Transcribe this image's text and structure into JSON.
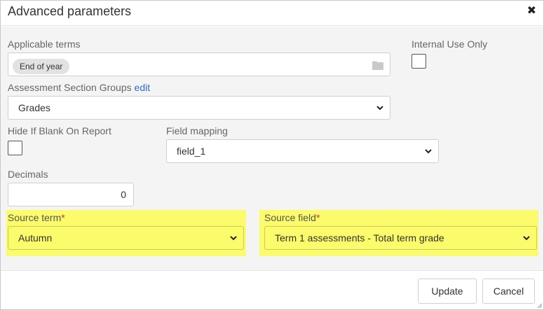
{
  "dialog": {
    "title": "Advanced parameters"
  },
  "applicable_terms": {
    "label": "Applicable terms",
    "tags": [
      "End of year"
    ]
  },
  "internal_use_only": {
    "label": "Internal Use Only",
    "checked": false
  },
  "assessment_section_groups": {
    "label": "Assessment Section Groups",
    "edit_label": "edit",
    "value": "Grades"
  },
  "hide_if_blank": {
    "label": "Hide If Blank On Report",
    "checked": false
  },
  "field_mapping": {
    "label": "Field mapping",
    "value": "field_1"
  },
  "decimals": {
    "label": "Decimals",
    "value": "0"
  },
  "source_term": {
    "label": "Source term",
    "required_mark": "*",
    "value": "Autumn"
  },
  "source_field": {
    "label": "Source field",
    "required_mark": "*",
    "value": "Term 1 assessments - Total term grade"
  },
  "highlight_color": "#fbfb6b",
  "footer": {
    "update_label": "Update",
    "cancel_label": "Cancel"
  }
}
